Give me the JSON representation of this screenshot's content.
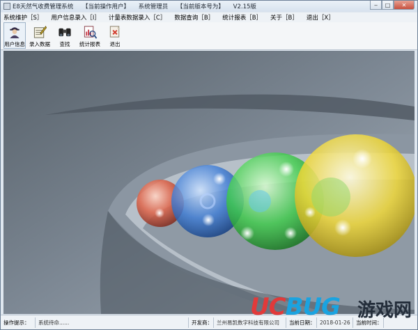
{
  "window": {
    "title_parts": [
      "E8天然气收费管理系统",
      "【当前操作用户】",
      "系统管理员",
      "【当前版本号为】",
      "V2.15版"
    ],
    "controls": {
      "minimize": "‒",
      "maximize": "□",
      "close": "✕"
    }
  },
  "menu": [
    "系统维护［S］",
    "用户信息录入［I］",
    "计量表数据录入［C］",
    "数据查询［B］",
    "统计报表［B］",
    "关于［B］",
    "退出［X］"
  ],
  "toolbar": [
    {
      "label": "用户信息",
      "icon": "user-icon"
    },
    {
      "label": "录入数据",
      "icon": "data-entry-icon"
    },
    {
      "label": "查找",
      "icon": "binoculars-icon"
    },
    {
      "label": "统计报表",
      "icon": "report-icon"
    },
    {
      "label": "退出",
      "icon": "exit-icon"
    }
  ],
  "status": {
    "hint_label": "操作提示：",
    "hint_value": "系统待命......",
    "dev_label": "开发商：",
    "dev_value": "兰州易凯数字科技有限公司",
    "date_label": "当前日期：",
    "date_value": "2018-01-26",
    "time_label": "当前时间："
  },
  "watermark": {
    "uc": "UC",
    "bug": "BUG",
    "cn": "游戏网"
  },
  "colors": {
    "sphere_red": "#e0654a",
    "sphere_blue": "#3f7ed8",
    "sphere_green": "#3fcf4a",
    "sphere_yellow": "#f0d83a",
    "close": "#c7503e"
  }
}
